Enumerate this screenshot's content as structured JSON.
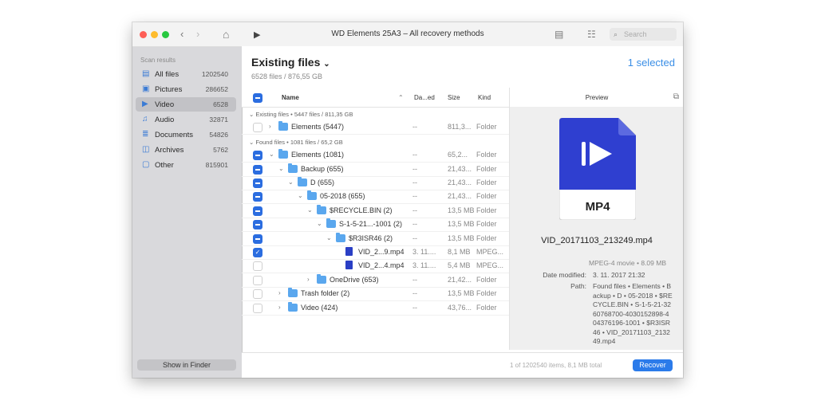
{
  "window": {
    "title": "WD Elements 25A3 – All recovery methods"
  },
  "toolbar": {
    "back_glyph": "‹",
    "forward_glyph": "›",
    "home_glyph": "⌂",
    "play_glyph": "▶",
    "view_glyph": "▤",
    "filter_glyph": "☷",
    "search_placeholder": "Search"
  },
  "sidebar": {
    "header": "Scan results",
    "items": [
      {
        "label": "All files",
        "count": "1202540",
        "icon": "files-icon",
        "glyph": "▤"
      },
      {
        "label": "Pictures",
        "count": "286652",
        "icon": "picture-icon",
        "glyph": "▣"
      },
      {
        "label": "Video",
        "count": "6528",
        "icon": "video-icon",
        "glyph": "▶"
      },
      {
        "label": "Audio",
        "count": "32871",
        "icon": "music-icon",
        "glyph": "♫"
      },
      {
        "label": "Documents",
        "count": "54826",
        "icon": "document-icon",
        "glyph": "≣"
      },
      {
        "label": "Archives",
        "count": "5762",
        "icon": "archive-icon",
        "glyph": "◫"
      },
      {
        "label": "Other",
        "count": "815901",
        "icon": "other-icon",
        "glyph": "▢"
      }
    ],
    "active": "Video",
    "show_in_finder": "Show in Finder"
  },
  "header": {
    "title": "Existing files",
    "title_caret": "⌄",
    "subtitle": "6528 files / 876,55 GB",
    "selected": "1 selected"
  },
  "columns": {
    "name": "Name",
    "sort_glyph": "⌃",
    "date": "Da...ed",
    "size": "Size",
    "kind": "Kind",
    "preview": "Preview"
  },
  "rows": [
    {
      "type": "section",
      "text": "⌄  Existing files • 5447 files / 811,35 GB"
    },
    {
      "type": "item",
      "check": "none",
      "depth": 0,
      "disc": "›",
      "icon": "folder",
      "name": "Elements (5447)",
      "date": "--",
      "size": "811,3...",
      "kind": "Folder"
    },
    {
      "type": "section",
      "text": "⌄  Found files • 1081 files / 65,2 GB"
    },
    {
      "type": "item",
      "check": "minus",
      "depth": 0,
      "disc": "⌄",
      "icon": "folder",
      "name": "Elements (1081)",
      "date": "--",
      "size": "65,2...",
      "kind": "Folder"
    },
    {
      "type": "item",
      "check": "minus",
      "depth": 1,
      "disc": "⌄",
      "icon": "folder",
      "name": "Backup (655)",
      "date": "--",
      "size": "21,43...",
      "kind": "Folder"
    },
    {
      "type": "item",
      "check": "minus",
      "depth": 2,
      "disc": "⌄",
      "icon": "folder",
      "name": "D (655)",
      "date": "--",
      "size": "21,43...",
      "kind": "Folder"
    },
    {
      "type": "item",
      "check": "minus",
      "depth": 3,
      "disc": "⌄",
      "icon": "folder",
      "name": "05-2018 (655)",
      "date": "--",
      "size": "21,43...",
      "kind": "Folder"
    },
    {
      "type": "item",
      "check": "minus",
      "depth": 4,
      "disc": "⌄",
      "icon": "folder",
      "name": "$RECYCLE.BIN (2)",
      "date": "--",
      "size": "13,5 MB",
      "kind": "Folder"
    },
    {
      "type": "item",
      "check": "minus",
      "depth": 5,
      "disc": "⌄",
      "icon": "folder",
      "name": "S-1-5-21...-1001 (2)",
      "date": "--",
      "size": "13,5 MB",
      "kind": "Folder"
    },
    {
      "type": "item",
      "check": "minus",
      "depth": 6,
      "disc": "⌄",
      "icon": "folder",
      "name": "$R3ISR46 (2)",
      "date": "--",
      "size": "13,5 MB",
      "kind": "Folder"
    },
    {
      "type": "item",
      "check": "check",
      "depth": 7,
      "disc": "",
      "icon": "file",
      "name": "VID_2...9.mp4",
      "date": "3. 11....",
      "size": "8,1 MB",
      "kind": "MPEG..."
    },
    {
      "type": "item",
      "check": "none",
      "depth": 7,
      "disc": "",
      "icon": "file",
      "name": "VID_2...4.mp4",
      "date": "3. 11....",
      "size": "5,4 MB",
      "kind": "MPEG..."
    },
    {
      "type": "item",
      "check": "none",
      "depth": 4,
      "disc": "›",
      "icon": "folder",
      "name": "OneDrive (653)",
      "date": "--",
      "size": "21,42...",
      "kind": "Folder"
    },
    {
      "type": "item",
      "check": "none",
      "depth": 1,
      "disc": "›",
      "icon": "folder",
      "name": "Trash folder (2)",
      "date": "--",
      "size": "13,5 MB",
      "kind": "Folder"
    },
    {
      "type": "item",
      "check": "none",
      "depth": 1,
      "disc": "›",
      "icon": "folder",
      "name": "Video (424)",
      "date": "--",
      "size": "43,76...",
      "kind": "Folder"
    }
  ],
  "preview": {
    "badge": "MP4",
    "filename": "VID_20171103_213249.mp4",
    "description": "MPEG-4 movie • 8.09 MB",
    "date_label": "Date modified:",
    "date_value": "3. 11. 2017 21:32",
    "path_label": "Path:",
    "path_value": "Found files • Elements • Backup • D • 05-2018 • $RECYCLE.BIN • S-1-5-21-3260768700-4030152898-404376196-1001 • $R3ISR46 • VID_20171103_213249.mp4",
    "copy_glyph": "⧉"
  },
  "footer": {
    "status": "1 of 1202540 items, 8,1 MB total",
    "recover": "Recover"
  },
  "colors": {
    "accent": "#2b7bea",
    "folder": "#5aa7ee",
    "file_icon": "#2a3fc5"
  }
}
